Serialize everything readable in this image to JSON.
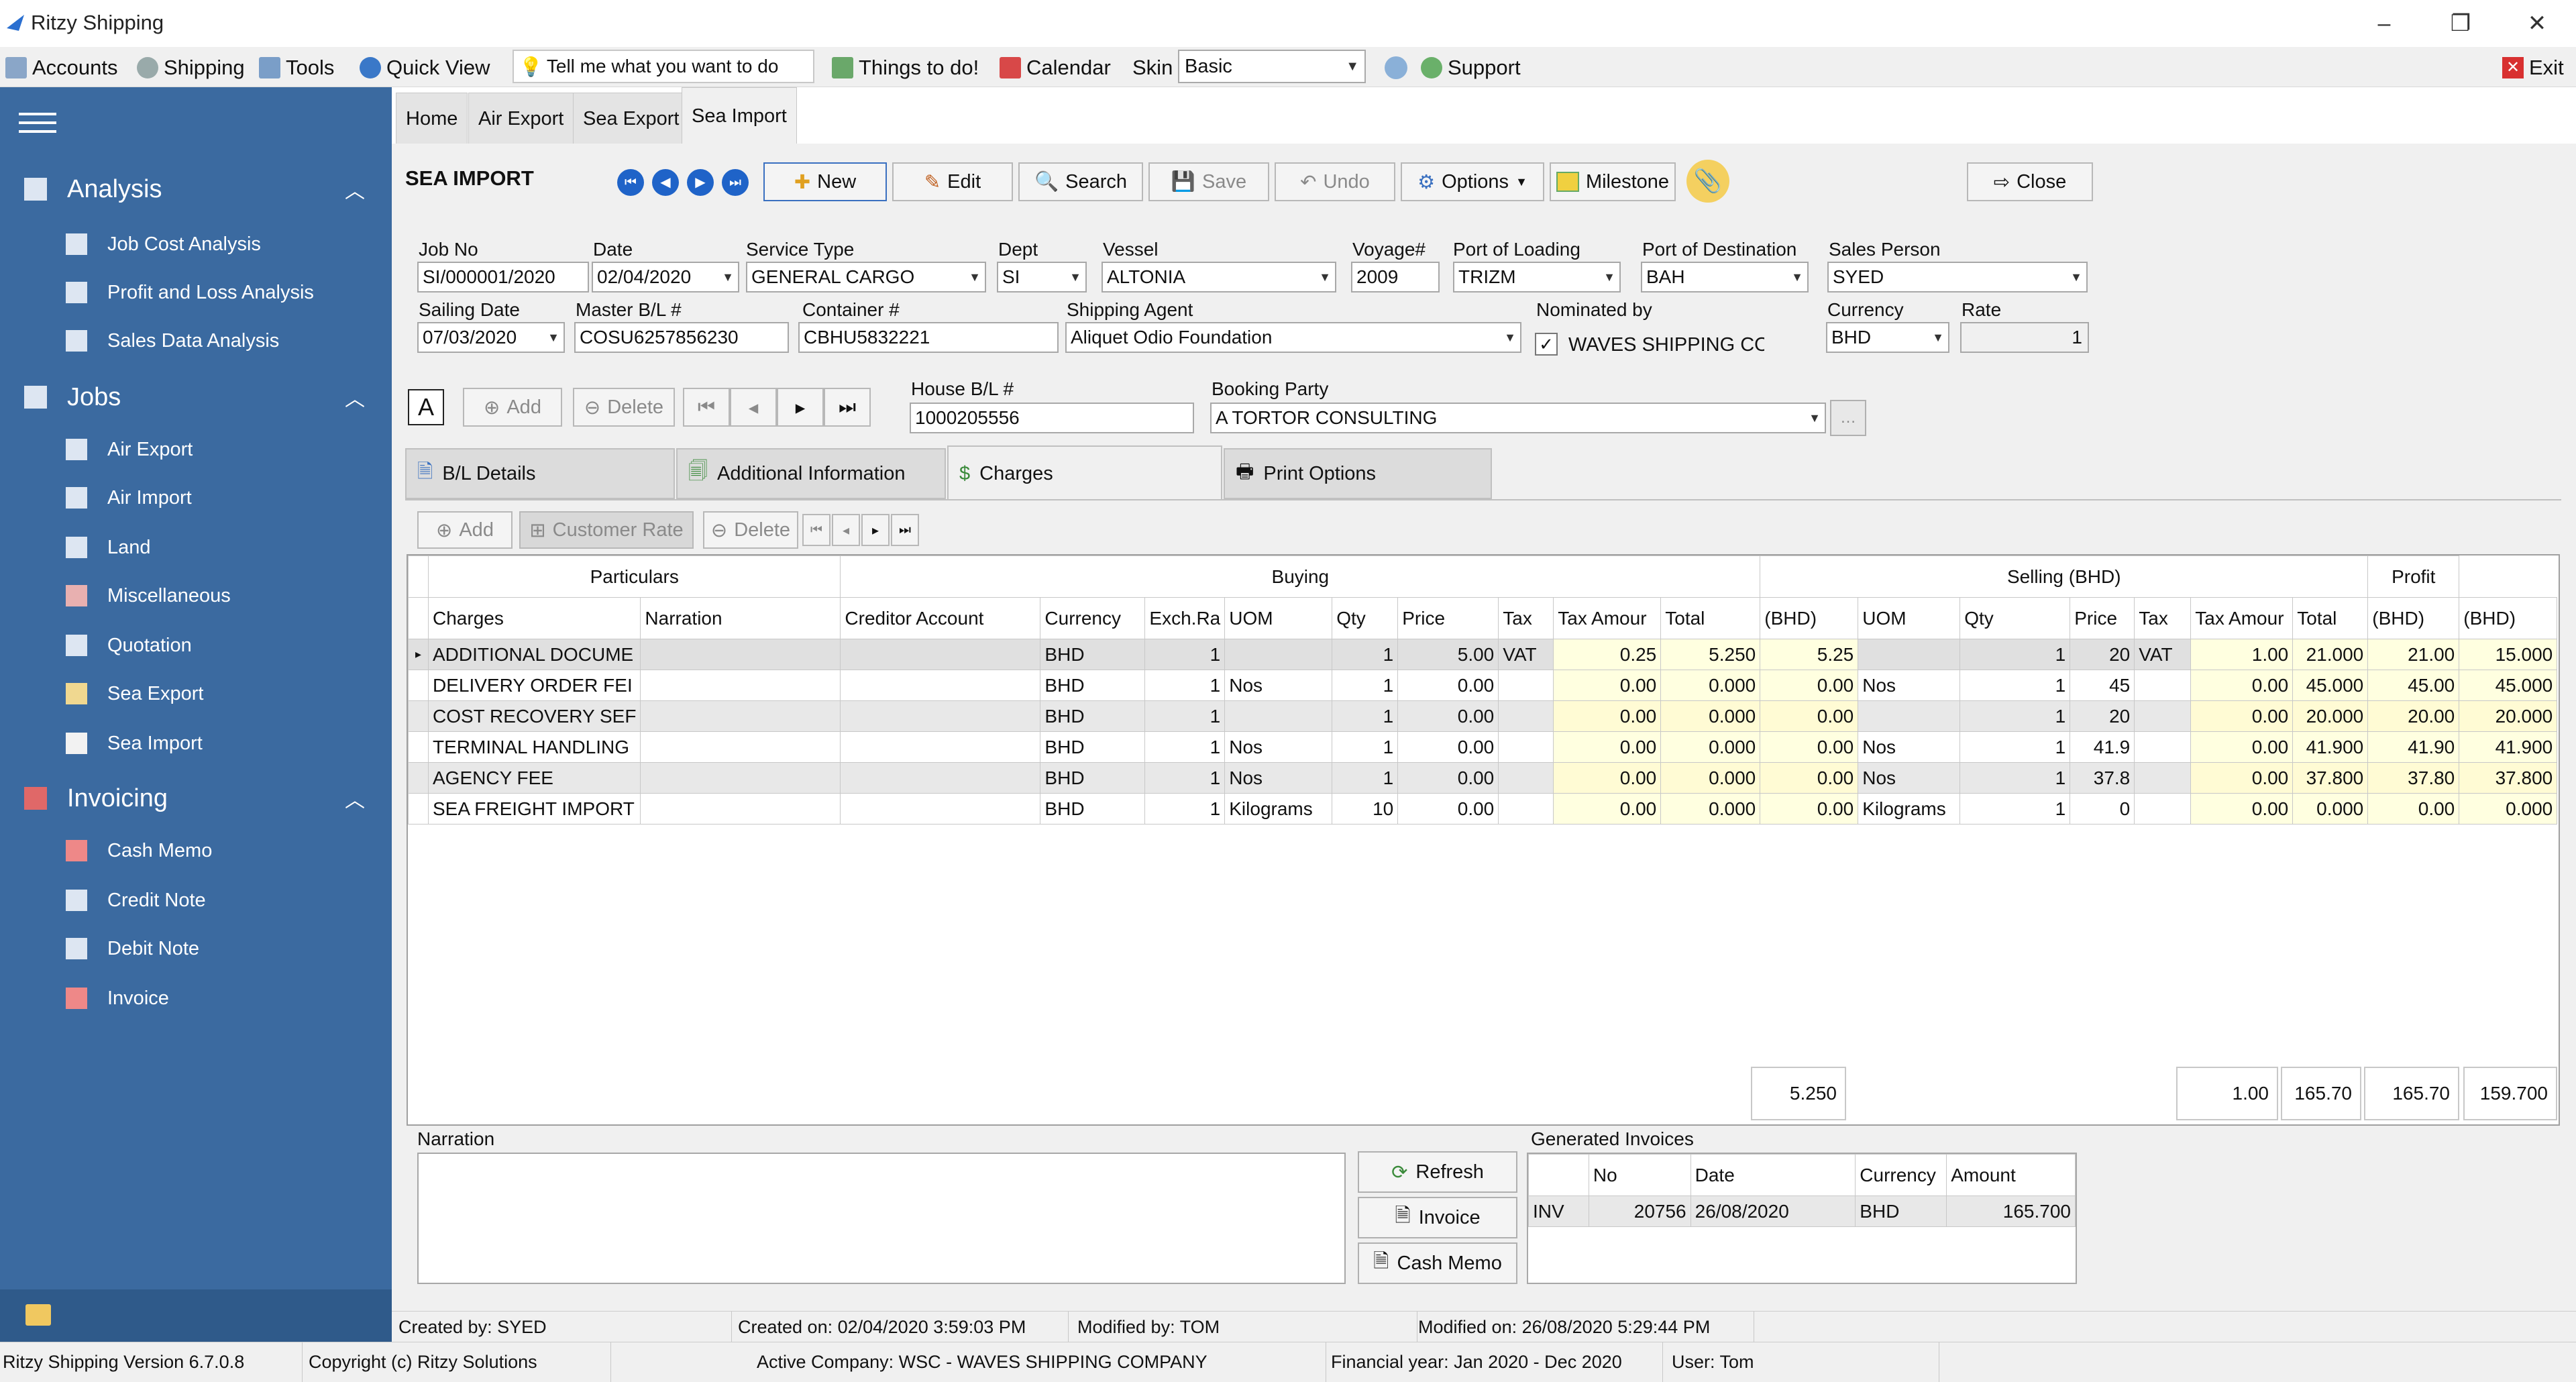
{
  "window": {
    "title": "Ritzy Shipping"
  },
  "menu": {
    "items": [
      "Accounts",
      "Shipping",
      "Tools",
      "Quick View"
    ],
    "tell_me": "Tell me what you want to do",
    "things_todo": "Things to do!",
    "calendar": "Calendar",
    "skin_label": "Skin",
    "skin_value": "Basic",
    "support": "Support",
    "exit": "Exit"
  },
  "sidebar": {
    "groups": [
      {
        "label": "Analysis",
        "items": [
          "Job Cost Analysis",
          "Profit and Loss Analysis",
          "Sales Data Analysis"
        ]
      },
      {
        "label": "Jobs",
        "items": [
          "Air Export",
          "Air Import",
          "Land",
          "Miscellaneous",
          "Quotation",
          "Sea Export",
          "Sea Import"
        ]
      },
      {
        "label": "Invoicing",
        "items": [
          "Cash Memo",
          "Credit Note",
          "Debit Note",
          "Invoice"
        ]
      }
    ]
  },
  "tabs": [
    "Home",
    "Air Export",
    "Sea Export",
    "Sea Import"
  ],
  "form": {
    "title": "SEA IMPORT",
    "toolbar": {
      "new": "New",
      "edit": "Edit",
      "search": "Search",
      "save": "Save",
      "undo": "Undo",
      "options": "Options",
      "milestone": "Milestone",
      "close": "Close"
    },
    "fields": {
      "job_no": {
        "label": "Job No",
        "value": "SI/000001/2020"
      },
      "date": {
        "label": "Date",
        "value": "02/04/2020"
      },
      "service_type": {
        "label": "Service Type",
        "value": "GENERAL CARGO"
      },
      "dept": {
        "label": "Dept",
        "value": "SI"
      },
      "vessel": {
        "label": "Vessel",
        "value": "ALTONIA"
      },
      "voyage": {
        "label": "Voyage#",
        "value": "2009"
      },
      "port_loading": {
        "label": "Port of Loading",
        "value": "TRIZM"
      },
      "port_destination": {
        "label": "Port of Destination",
        "value": "BAH"
      },
      "sales_person": {
        "label": "Sales Person",
        "value": "SYED"
      },
      "sailing_date": {
        "label": "Sailing Date",
        "value": "07/03/2020"
      },
      "master_bl": {
        "label": "Master B/L #",
        "value": "COSU6257856230"
      },
      "container": {
        "label": "Container #",
        "value": "CBHU5832221"
      },
      "shipping_agent": {
        "label": "Shipping Agent",
        "value": "Aliquet Odio Foundation"
      },
      "nominated_by": {
        "label": "Nominated by",
        "value": "WAVES SHIPPING CO"
      },
      "currency": {
        "label": "Currency",
        "value": "BHD"
      },
      "rate": {
        "label": "Rate",
        "value": "1"
      },
      "house_bl": {
        "label": "House B/L #",
        "value": "1000205556"
      },
      "booking_party": {
        "label": "Booking Party",
        "value": "A TORTOR CONSULTING"
      }
    },
    "bl_buttons": {
      "font": "A",
      "add": "Add",
      "delete": "Delete"
    },
    "subtabs": [
      "B/L Details",
      "Additional Information",
      "Charges",
      "Print Options"
    ],
    "charges_toolbar": {
      "add": "Add",
      "customer_rate": "Customer Rate",
      "delete": "Delete"
    }
  },
  "grid": {
    "bands": {
      "particulars": "Particulars",
      "buying": "Buying",
      "selling": "Selling (BHD)",
      "profit": "Profit"
    },
    "columns": [
      "Charges",
      "Narration",
      "Creditor Account",
      "Currency",
      "Exch.Ra",
      "UOM",
      "Qty",
      "Price",
      "Tax",
      "Tax Amour",
      "Total",
      "(BHD)",
      "UOM",
      "Qty",
      "Price",
      "Tax",
      "Tax Amour",
      "Total",
      "(BHD)",
      "(BHD)"
    ],
    "rows": [
      [
        "ADDITIONAL DOCUME",
        "",
        "",
        "BHD",
        "1",
        "",
        "1",
        "5.00",
        "VAT",
        "0.25",
        "5.250",
        "5.25",
        "",
        "1",
        "20",
        "VAT",
        "1.00",
        "21.000",
        "21.00",
        "15.000"
      ],
      [
        "DELIVERY ORDER FEI",
        "",
        "",
        "BHD",
        "1",
        "Nos",
        "1",
        "0.00",
        "",
        "0.00",
        "0.000",
        "0.00",
        "Nos",
        "1",
        "45",
        "",
        "0.00",
        "45.000",
        "45.00",
        "45.000"
      ],
      [
        "COST RECOVERY SEF",
        "",
        "",
        "BHD",
        "1",
        "",
        "1",
        "0.00",
        "",
        "0.00",
        "0.000",
        "0.00",
        "",
        "1",
        "20",
        "",
        "0.00",
        "20.000",
        "20.00",
        "20.000"
      ],
      [
        "TERMINAL HANDLING",
        "",
        "",
        "BHD",
        "1",
        "Nos",
        "1",
        "0.00",
        "",
        "0.00",
        "0.000",
        "0.00",
        "Nos",
        "1",
        "41.9",
        "",
        "0.00",
        "41.900",
        "41.90",
        "41.900"
      ],
      [
        "AGENCY FEE",
        "",
        "",
        "BHD",
        "1",
        "Nos",
        "1",
        "0.00",
        "",
        "0.00",
        "0.000",
        "0.00",
        "Nos",
        "1",
        "37.8",
        "",
        "0.00",
        "37.800",
        "37.80",
        "37.800"
      ],
      [
        "SEA FREIGHT IMPORT",
        "",
        "",
        "BHD",
        "1",
        "Kilograms",
        "10",
        "0.00",
        "",
        "0.00",
        "0.000",
        "0.00",
        "Kilograms",
        "1",
        "0",
        "",
        "0.00",
        "0.000",
        "0.00",
        "0.000"
      ]
    ],
    "totals": {
      "buy_total": "5.250",
      "sell_tax": "1.00",
      "sell_total": "165.70",
      "sell_bhd": "165.70",
      "profit": "159.700"
    }
  },
  "bottom": {
    "narration_label": "Narration",
    "refresh": "Refresh",
    "invoice": "Invoice",
    "cash_memo": "Cash Memo",
    "generated_label": "Generated Invoices",
    "inv_columns": [
      "No",
      "Date",
      "Currency",
      "Amount"
    ],
    "inv_row": {
      "type": "INV",
      "no": "20756",
      "date": "26/08/2020",
      "currency": "BHD",
      "amount": "165.700"
    }
  },
  "status": {
    "created_by": "Created by: SYED",
    "created_on": "Created on: 02/04/2020 3:59:03 PM",
    "modified_by": "Modified by: TOM",
    "modified_on": "Modified on: 26/08/2020 5:29:44 PM",
    "version": "Ritzy Shipping Version 6.7.0.8",
    "copyright": "Copyright (c) Ritzy Solutions",
    "company": "Active Company: WSC - WAVES SHIPPING COMPANY",
    "fy": "Financial year: Jan 2020 - Dec 2020",
    "user": "User: Tom"
  },
  "colors": {
    "sidebar": "#3b6aa0",
    "accent_blue": "#1f63c8",
    "highlight_yellow": "#ffffe0"
  }
}
